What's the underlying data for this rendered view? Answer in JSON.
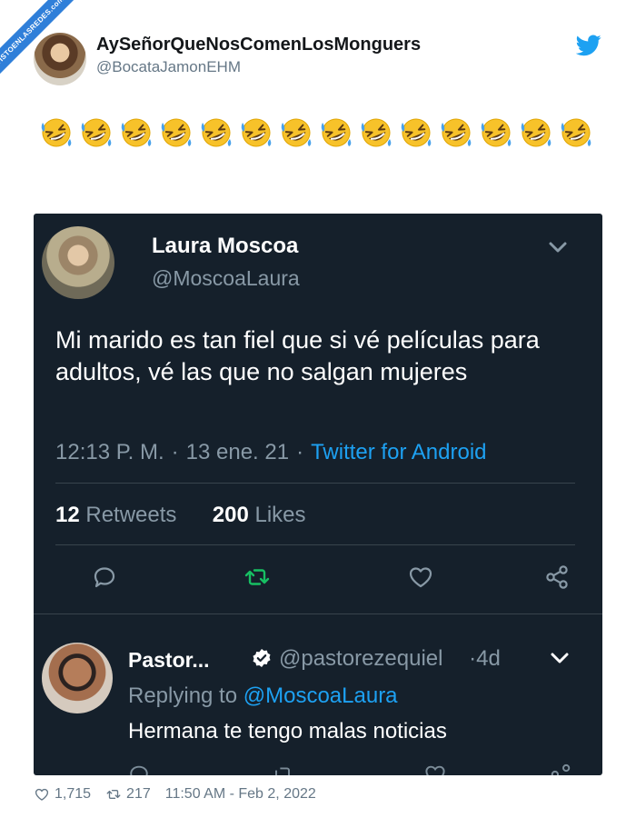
{
  "watermark": "VISTOENLASREDES.com",
  "author": {
    "display_name": "AySeñorQueNosComenLosMonguers",
    "handle": "@BocataJamonEHM"
  },
  "tweet": {
    "emoji_count": 14,
    "emoji_name": "rolling-on-the-floor-laughing"
  },
  "quoted": {
    "display_name": "Laura Moscoa",
    "handle": "@MoscoaLaura",
    "text": "Mi marido es tan fiel que si vé películas para adultos, vé las que no salgan mujeres",
    "time": "12:13 P. M.",
    "dot": "·",
    "date": "13 ene. 21",
    "app": "Twitter for Android",
    "retweets_count": "12",
    "retweets_label": "Retweets",
    "likes_count": "200",
    "likes_label": "Likes"
  },
  "reply": {
    "display_name": "Pastor...",
    "handle": "@pastorezequiel",
    "age": "·4d",
    "replying_prefix": "Replying to",
    "replying_to": "@MoscoaLaura",
    "text": "Hermana te tengo malas noticias"
  },
  "footer": {
    "likes": "1,715",
    "retweets": "217",
    "timestamp": "11:50 AM - Feb 2, 2022"
  },
  "colors": {
    "twitter_blue": "#1da1f2",
    "card_bg": "#15202b",
    "retweet_green": "#17bf63",
    "muted": "#8899a6"
  }
}
